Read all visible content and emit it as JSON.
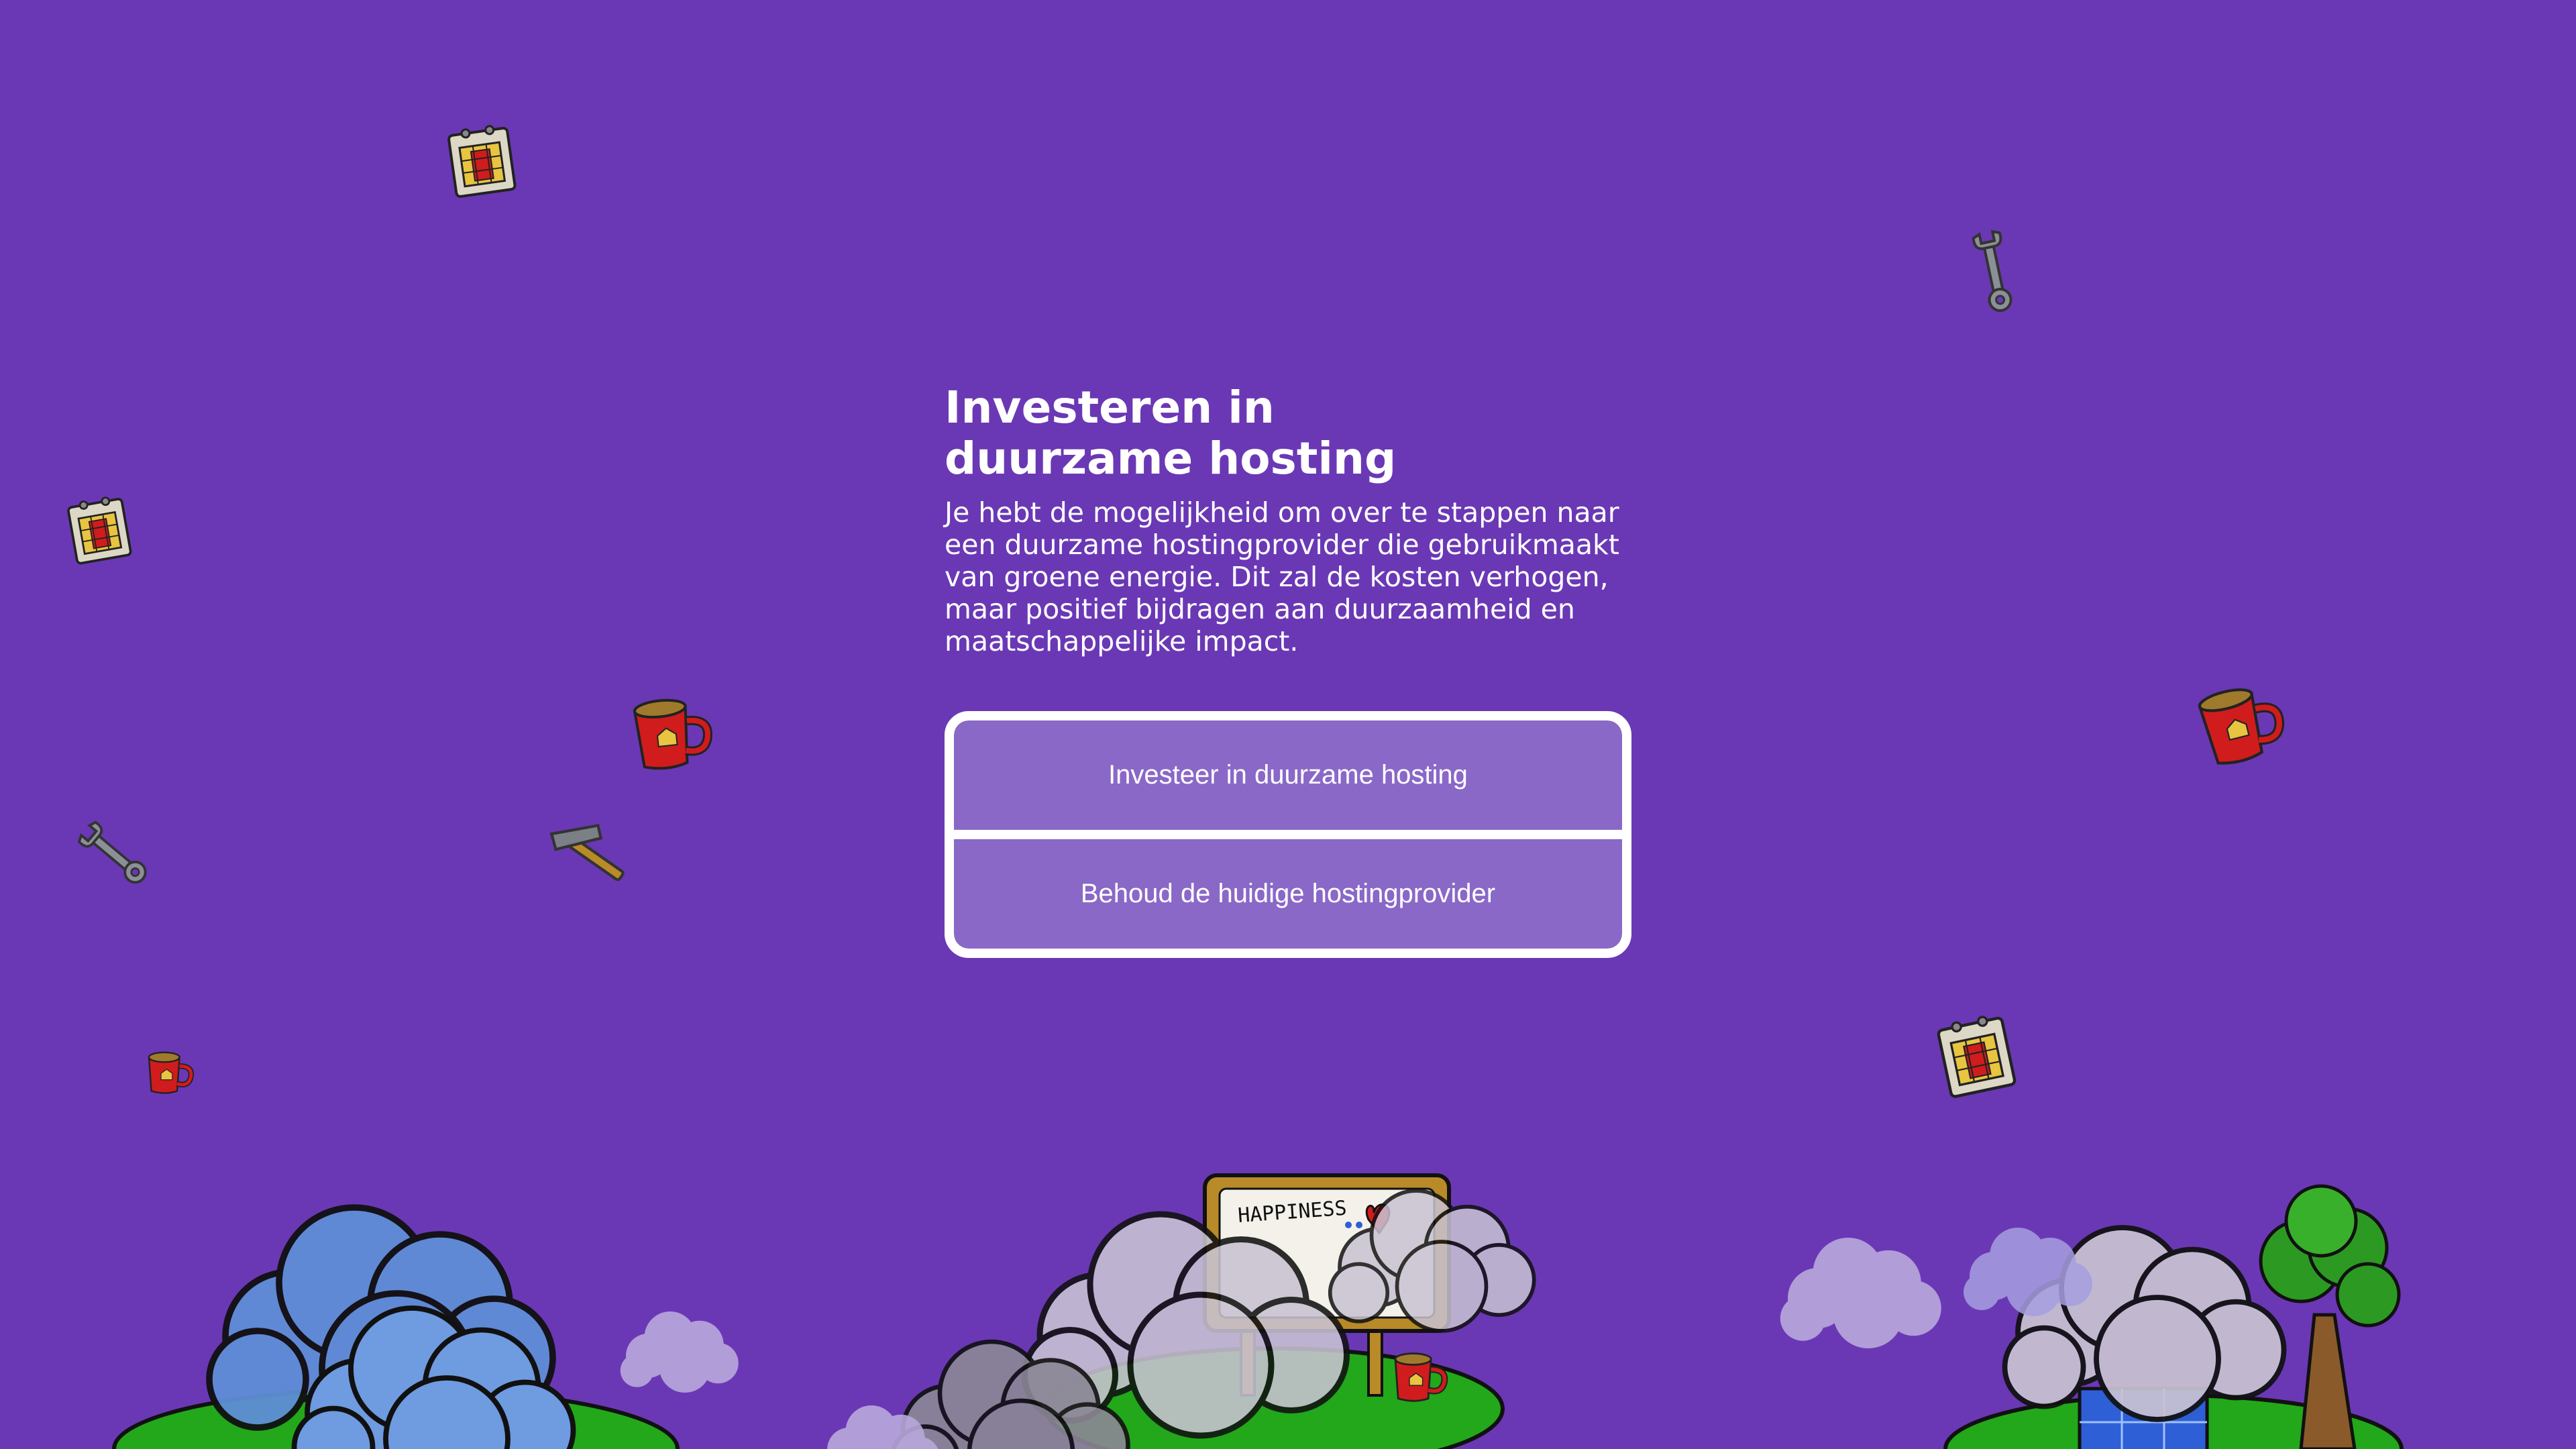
{
  "page": {
    "background_color": "#6a38b5"
  },
  "dialog": {
    "title": "Investeren in duurzame hosting",
    "description": "Je hebt de mogelijkheid om over te stappen naar een duurzame hostingprovider die gebruikmaakt van groene energie. Dit zal de kosten verhogen, maar positief bijdragen aan duurzaamheid en maatschappelijke impact.",
    "options": [
      {
        "label": "Investeer in duurzame hosting"
      },
      {
        "label": "Behoud de huidige hostingprovider"
      }
    ]
  },
  "scene": {
    "sign_text": "HAPPINESS",
    "decorations": [
      "calendar-icon",
      "wrench-icon",
      "mug-icon",
      "hammer-icon"
    ],
    "colors": {
      "mug": "#d01c1c",
      "grass": "#22a81a",
      "cloud_gray": "#c9c3d3",
      "cloud_blue": "#5f8ed6",
      "tree_green": "#2c9a22",
      "solar_blue": "#2e5fd6"
    }
  }
}
